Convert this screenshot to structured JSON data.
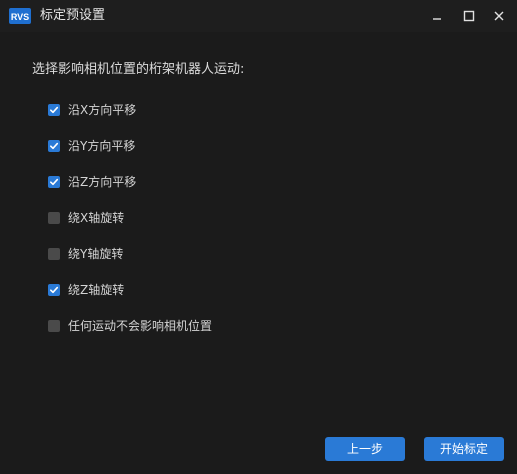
{
  "window": {
    "title": "标定预设置",
    "logo_text": "RVS"
  },
  "prompt": "选择影响相机位置的桁架机器人运动:",
  "options": [
    {
      "label": "沿X方向平移",
      "checked": true
    },
    {
      "label": "沿Y方向平移",
      "checked": true
    },
    {
      "label": "沿Z方向平移",
      "checked": true
    },
    {
      "label": "绕X轴旋转",
      "checked": false
    },
    {
      "label": "绕Y轴旋转",
      "checked": false
    },
    {
      "label": "绕Z轴旋转",
      "checked": true
    },
    {
      "label": "任何运动不会影响相机位置",
      "checked": false
    }
  ],
  "buttons": {
    "back": "上一步",
    "start": "开始标定"
  },
  "colors": {
    "accent": "#2a7ad6",
    "background": "#1b1b1b",
    "unchecked": "#4a4a4a"
  }
}
